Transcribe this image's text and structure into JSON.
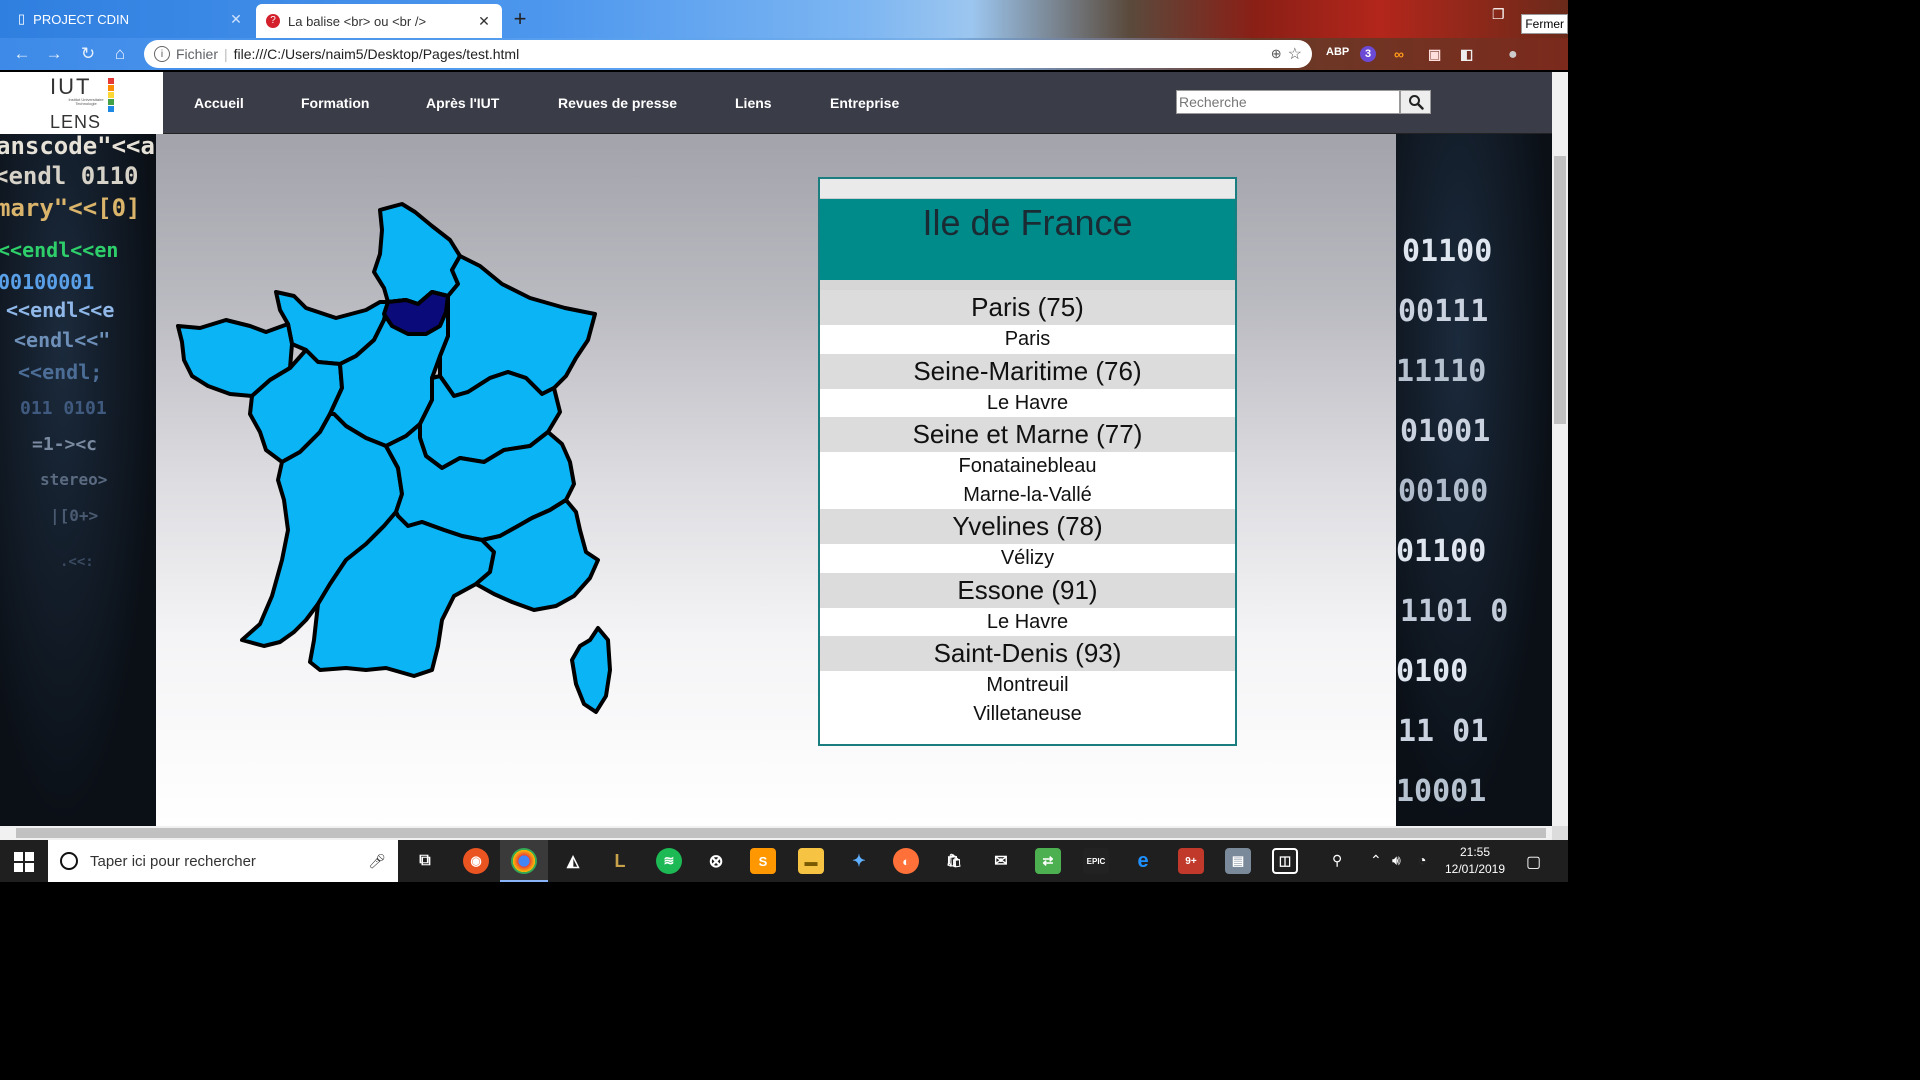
{
  "browser": {
    "tabs": [
      {
        "title": "PROJECT CDIN",
        "active": false
      },
      {
        "title": "La balise <br> ou <br />",
        "active": true
      }
    ],
    "url_scheme": "Fichier",
    "url": "file:///C:/Users/naim5/Desktop/Pages/test.html",
    "close_tooltip": "Fermer",
    "extensions": [
      "ABP",
      "3"
    ]
  },
  "site": {
    "logo": {
      "line1": "IUT",
      "line2": "LENS",
      "sub": "Institut Universitaire Technologie"
    },
    "menu": [
      "Accueil",
      "Formation",
      "Après l'IUT",
      "Revues de presse",
      "Liens",
      "Entreprise"
    ],
    "search_placeholder": "Recherche"
  },
  "region": {
    "title": "Ile de France",
    "departments": [
      {
        "name": "Paris (75)",
        "cities": [
          "Paris"
        ]
      },
      {
        "name": "Seine-Maritime (76)",
        "cities": [
          "Le Havre"
        ]
      },
      {
        "name": "Seine et Marne (77)",
        "cities": [
          "Fonatainebleau",
          "Marne-la-Vallé"
        ]
      },
      {
        "name": "Yvelines (78)",
        "cities": [
          "Vélizy"
        ]
      },
      {
        "name": "Essone (91)",
        "cities": [
          "Le Havre"
        ]
      },
      {
        "name": "Saint-Denis (93)",
        "cities": [
          "Montreuil",
          "Villetaneuse"
        ]
      }
    ]
  },
  "map": {
    "region_color": "#0bb4f5",
    "highlight_color": "#0a0a7a"
  },
  "taskbar": {
    "search_text": "Taper ici pour rechercher",
    "time": "21:55",
    "date": "12/01/2019"
  }
}
